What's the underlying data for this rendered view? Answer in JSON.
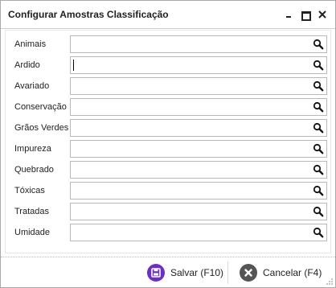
{
  "window": {
    "title": "Configurar Amostras Classificação"
  },
  "fields": [
    {
      "label": "Animais",
      "value": ""
    },
    {
      "label": "Ardido",
      "value": ""
    },
    {
      "label": "Avariado",
      "value": ""
    },
    {
      "label": "Conservação",
      "value": ""
    },
    {
      "label": "Grãos Verdes",
      "value": ""
    },
    {
      "label": "Impureza",
      "value": ""
    },
    {
      "label": "Quebrado",
      "value": ""
    },
    {
      "label": "Tóxicas",
      "value": ""
    },
    {
      "label": "Tratadas",
      "value": ""
    },
    {
      "label": "Umidade",
      "value": ""
    }
  ],
  "focused_field": "Ardido",
  "footer": {
    "save_label": "Salvar (F10)",
    "cancel_label": "Cancelar (F4)"
  },
  "icons": {
    "field_action": "search-icon",
    "save": "floppy-disk-icon",
    "cancel": "close-circle-icon"
  },
  "colors": {
    "save_accent": "#6a2fc8",
    "cancel_accent": "#555555"
  }
}
